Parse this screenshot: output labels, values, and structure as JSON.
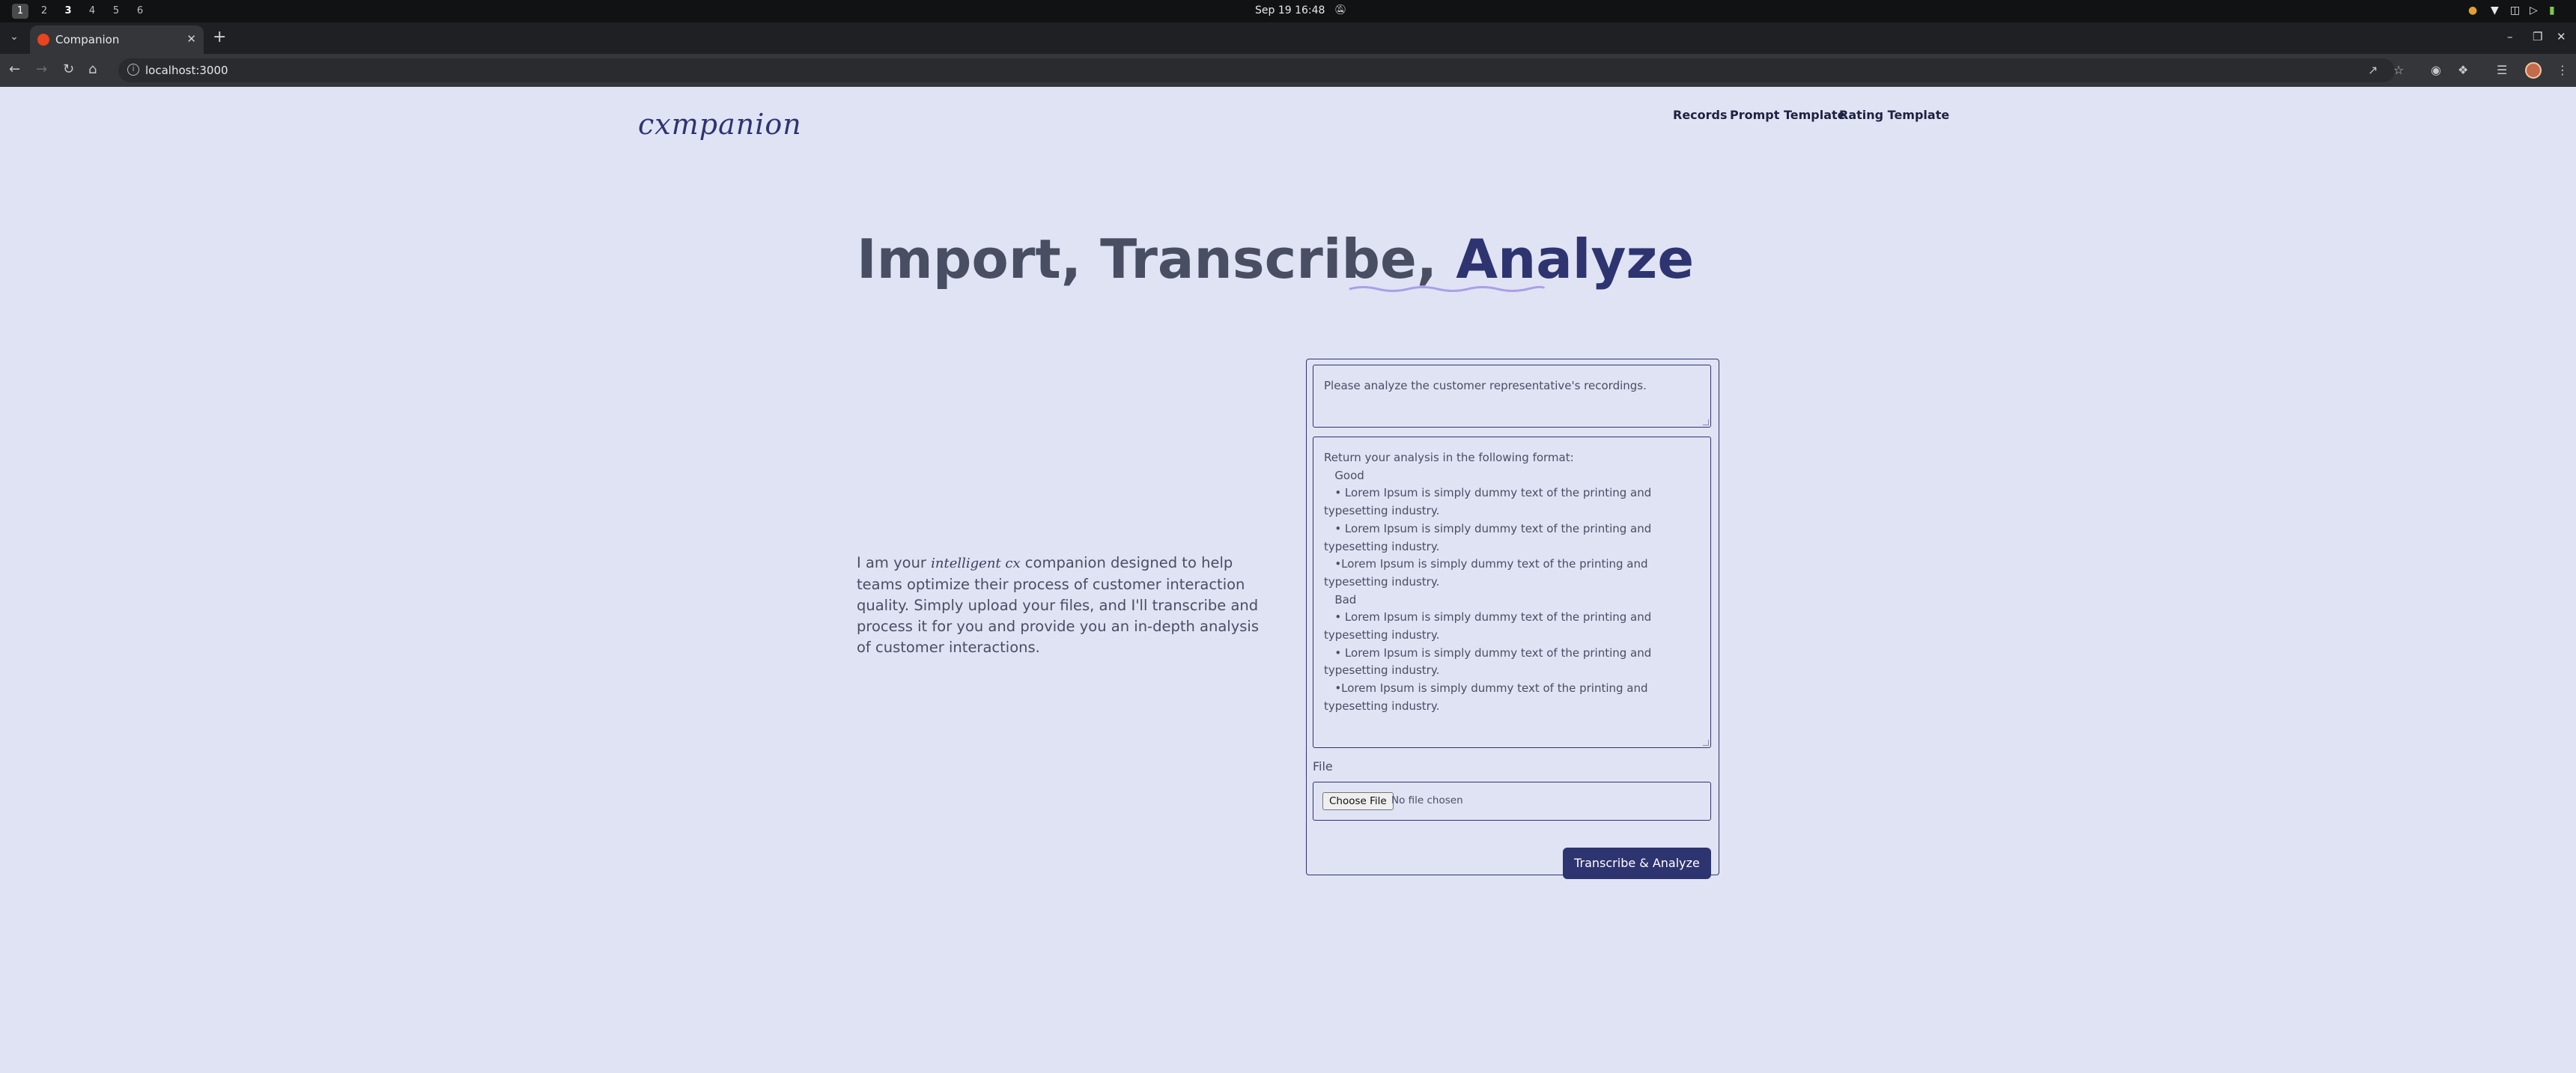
{
  "system_bar": {
    "workspaces": [
      "1",
      "2",
      "3",
      "4",
      "5",
      "6"
    ],
    "clock": "Sep 19  16:48"
  },
  "browser": {
    "tab_title": "Companion",
    "url": "localhost:3000"
  },
  "header": {
    "logo": "cxmpanion",
    "nav": [
      "Records",
      "Prompt Template",
      "Rating Template"
    ]
  },
  "hero": {
    "title_plain": "Import, Transcribe, ",
    "title_accent": "Analyze"
  },
  "intro": {
    "before": "I am your ",
    "script": "intelligent cx",
    "after": " companion designed to help teams optimize their process of customer interaction quality. Simply upload your files, and I'll transcribe and process it for you and provide you an in-depth analysis of customer interactions."
  },
  "form": {
    "prompt_value": "Please analyze the customer representative's recordings.",
    "format_value": "Return your analysis in the following format:\n   Good\n   • Lorem Ipsum is simply dummy text of the printing and typesetting industry.\n   • Lorem Ipsum is simply dummy text of the printing and typesetting industry.\n   •Lorem Ipsum is simply dummy text of the printing and typesetting industry.\n   Bad\n   • Lorem Ipsum is simply dummy text of the printing and typesetting industry.\n   • Lorem Ipsum is simply dummy text of the printing and typesetting industry.\n   •Lorem Ipsum is simply dummy text of the printing and typesetting industry.",
    "file_label": "File",
    "choose_file": "Choose File",
    "no_file": "No file chosen",
    "submit_label": "Transcribe & Analyze"
  },
  "colors": {
    "page_bg": "#e0e3f4",
    "accent": "#2e3470",
    "text": "#4a4e63",
    "underline": "#a9a0e8"
  }
}
